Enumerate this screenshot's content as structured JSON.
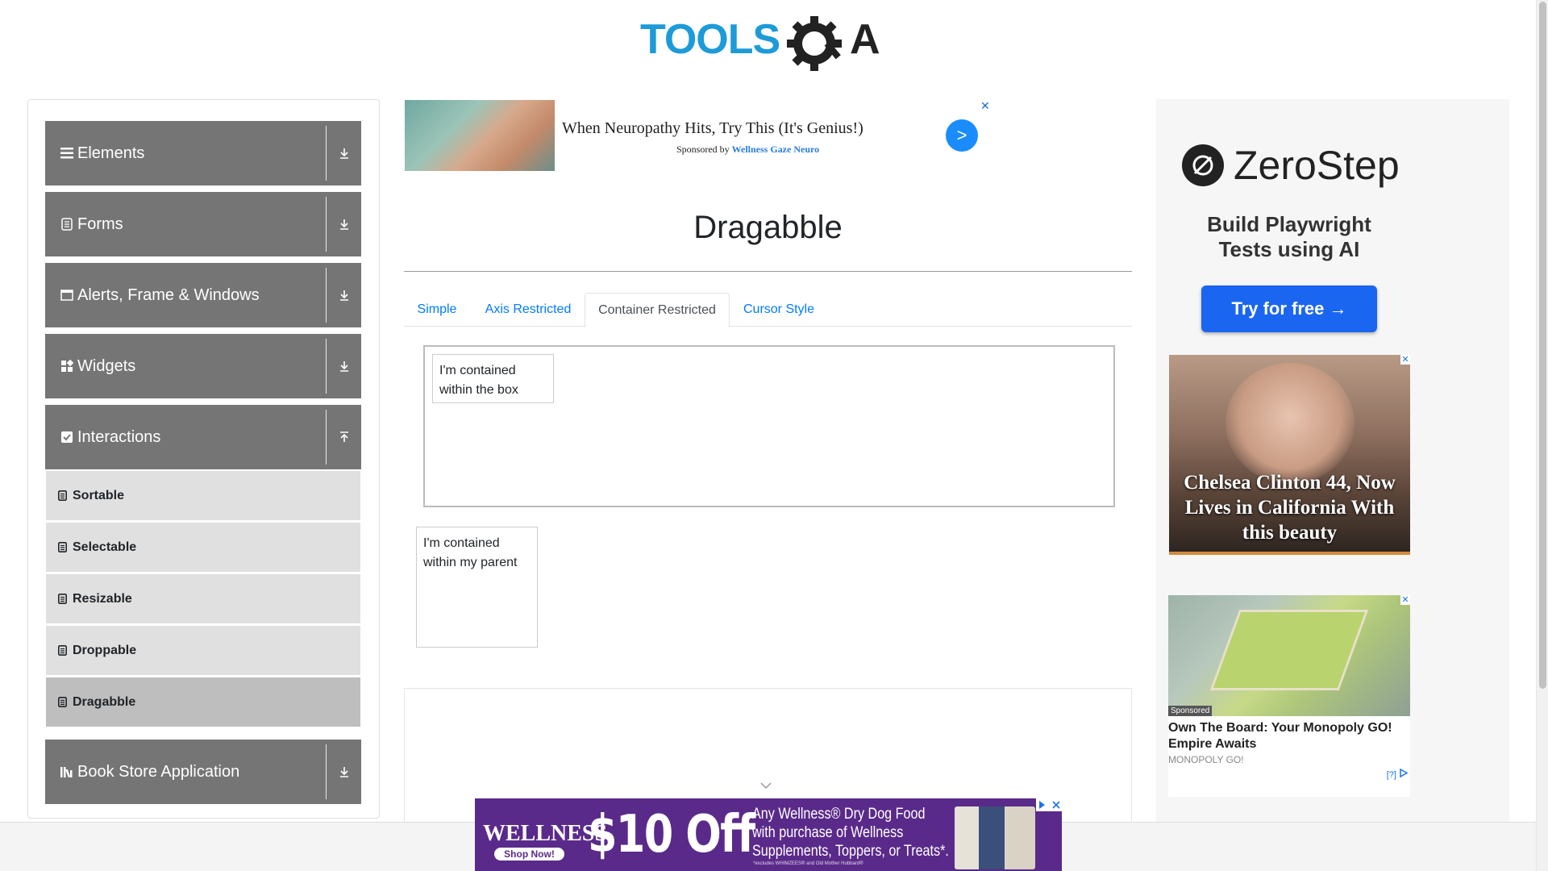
{
  "header": {
    "logo_text_tools": "TOOLS",
    "logo_text_qa": "QA"
  },
  "sidebar": {
    "groups": [
      {
        "label": "Elements",
        "icon": "hamburger-icon"
      },
      {
        "label": "Forms",
        "icon": "form-icon"
      },
      {
        "label": "Alerts, Frame & Windows",
        "icon": "window-icon"
      },
      {
        "label": "Widgets",
        "icon": "widgets-icon"
      },
      {
        "label": "Interactions",
        "icon": "interactions-icon"
      },
      {
        "label": "Book Store Application",
        "icon": "books-icon"
      }
    ],
    "interaction_items": [
      {
        "label": "Sortable"
      },
      {
        "label": "Selectable"
      },
      {
        "label": "Resizable"
      },
      {
        "label": "Droppable"
      },
      {
        "label": "Dragabble"
      }
    ]
  },
  "top_ad": {
    "headline": "When Neuropathy Hits, Try This (It's Genius!)",
    "sponsored_by": "Sponsored by",
    "sponsor": "Wellness Gaze Neuro",
    "go": ">",
    "close": "✕"
  },
  "main": {
    "title": "Dragabble",
    "tabs": [
      {
        "label": "Simple"
      },
      {
        "label": "Axis Restricted"
      },
      {
        "label": "Container Restricted"
      },
      {
        "label": "Cursor Style"
      }
    ],
    "active_tab": "Container Restricted",
    "box_drag_text": "I'm contained within the box",
    "parent_drag_text": "I'm contained within my parent"
  },
  "right_ads": {
    "zerostep": {
      "brand": "ZeroStep",
      "tagline_1": "Build Playwright",
      "tagline_2": "Tests using AI",
      "button": "Try for free →"
    },
    "chelsea": {
      "caption": "Chelsea Clinton 44, Now Lives in California With this beauty"
    },
    "monopoly": {
      "sponsored": "Sponsored",
      "headline": "Own The Board: Your Monopoly GO! Empire Awaits",
      "source": "MONOPOLY GO!",
      "info": "[?]"
    }
  },
  "bottom_ad": {
    "brand": "WELLNESS",
    "shop": "Shop Now!",
    "price": "$10 Off",
    "copy_1": "Any Wellness® Dry Dog Food",
    "copy_2": "with purchase of Wellness",
    "copy_3": "Supplements, Toppers, or Treats*.",
    "fine": "*excludes WHIMZEES® and Old Mother Hubbard®"
  },
  "colors": {
    "sidebar_group": "#757575",
    "sidebar_item": "#e0e0e0",
    "sidebar_item_active": "#bebebe",
    "link": "#007bff",
    "logo_blue": "#1d9bd8",
    "bottom_ad_purple": "#5a2a8a"
  }
}
